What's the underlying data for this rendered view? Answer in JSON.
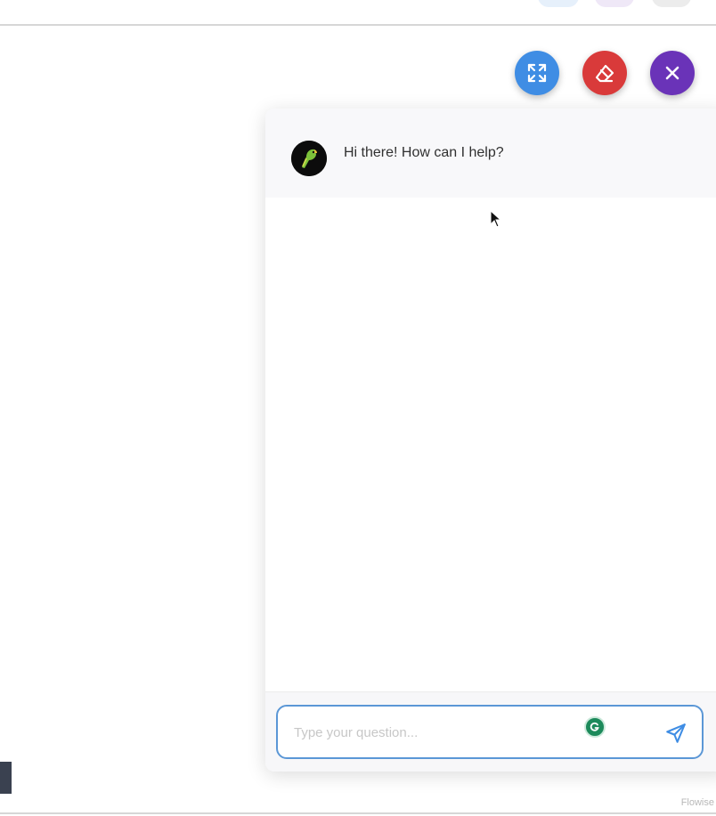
{
  "header": {
    "icons": [
      "faint-blue-button",
      "faint-purple-button",
      "faint-gray-button"
    ]
  },
  "toolbar": {
    "expand": {
      "icon": "expand-arrows-icon",
      "color": "#3f8de4"
    },
    "clear": {
      "icon": "eraser-icon",
      "color": "#d93a3a"
    },
    "close": {
      "icon": "close-icon",
      "color": "#6a33b8"
    }
  },
  "chat": {
    "messages": [
      {
        "sender": "bot",
        "avatar_icon": "parrot-avatar-icon",
        "text": "Hi there! How can I help?"
      }
    ],
    "input": {
      "placeholder": "Type your question...",
      "value": "",
      "border_color": "#5b97d6"
    },
    "send_icon": "send-icon",
    "grammarly_icon": "grammarly-icon"
  },
  "watermark": "Flowise"
}
